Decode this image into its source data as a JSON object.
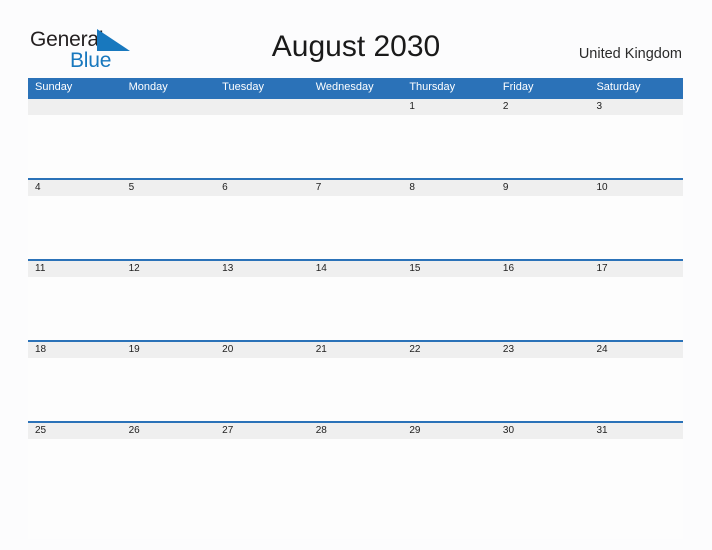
{
  "logo": {
    "word_one": "General",
    "word_two": "Blue",
    "flag_icon": "blue-triangle-flag-icon",
    "accent_color": "#1878be",
    "text_color": "#231f20"
  },
  "header": {
    "title": "August 2030",
    "region": "United Kingdom"
  },
  "calendar": {
    "header_bg": "#2b72b8",
    "date_strip_bg": "#efefef",
    "row_border_color": "#2b72b8",
    "weekdays": [
      "Sunday",
      "Monday",
      "Tuesday",
      "Wednesday",
      "Thursday",
      "Friday",
      "Saturday"
    ],
    "weeks": [
      [
        "",
        "",
        "",
        "",
        "1",
        "2",
        "3"
      ],
      [
        "4",
        "5",
        "6",
        "7",
        "8",
        "9",
        "10"
      ],
      [
        "11",
        "12",
        "13",
        "14",
        "15",
        "16",
        "17"
      ],
      [
        "18",
        "19",
        "20",
        "21",
        "22",
        "23",
        "24"
      ],
      [
        "25",
        "26",
        "27",
        "28",
        "29",
        "30",
        "31"
      ]
    ]
  }
}
